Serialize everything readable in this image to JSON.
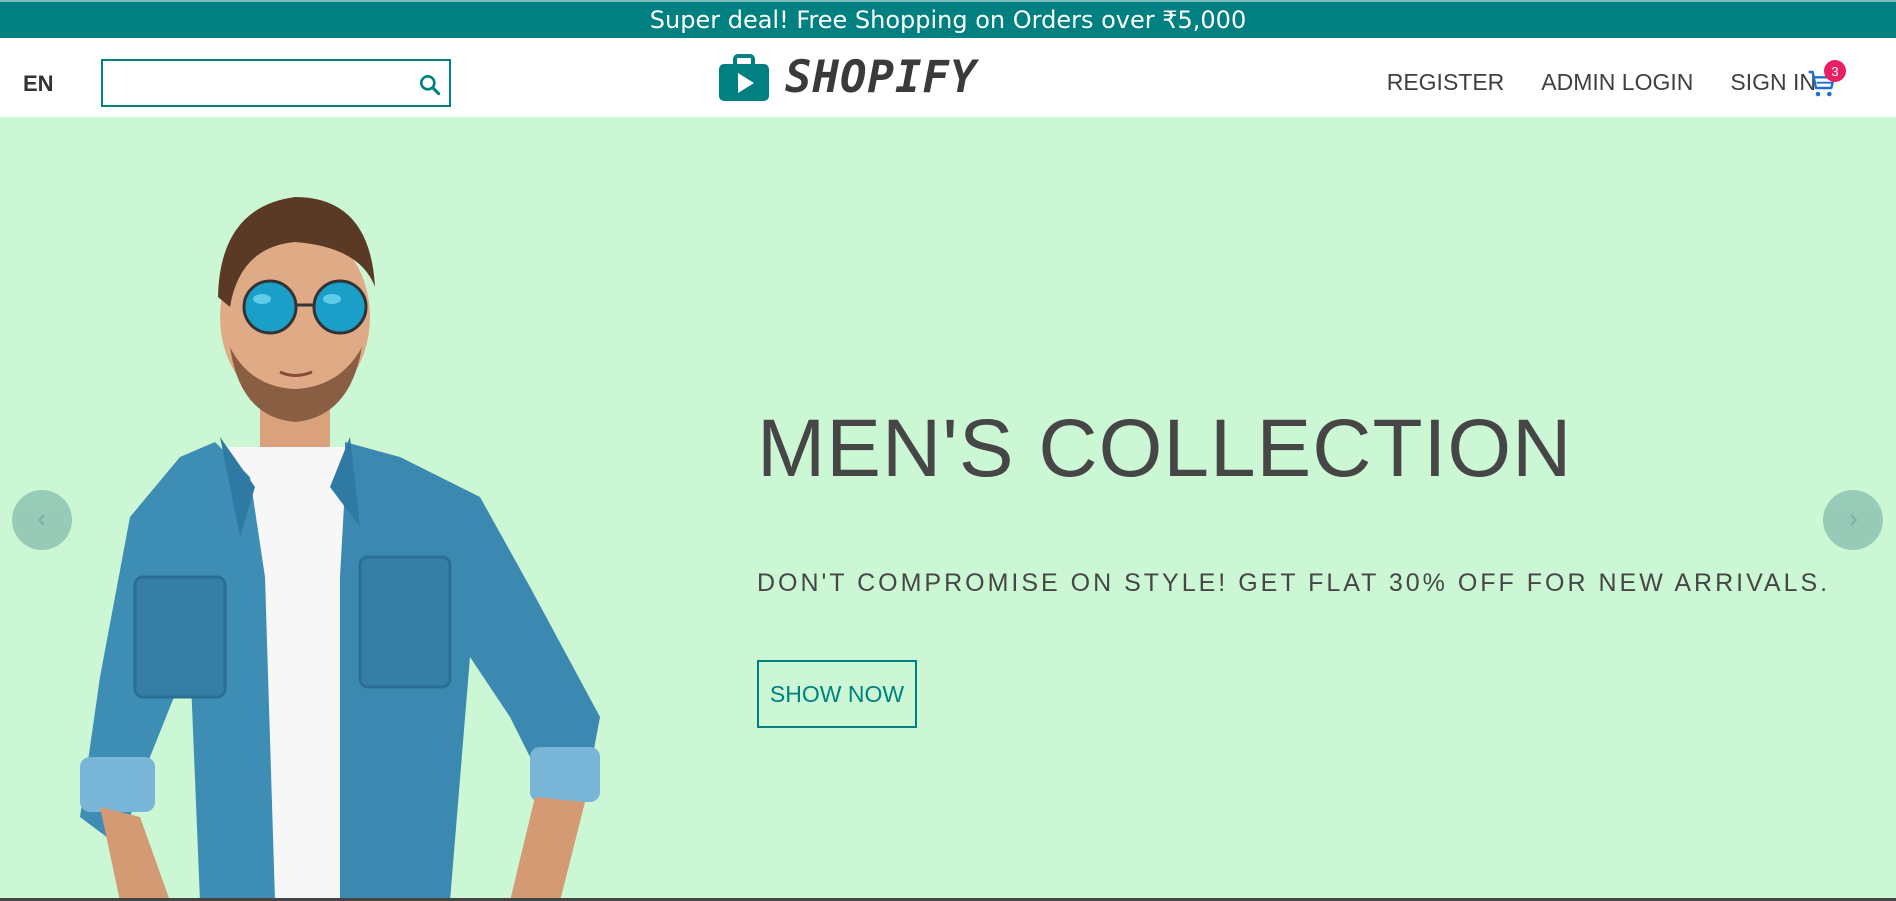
{
  "announcement": {
    "text": "Super deal! Free Shopping on Orders over ₹5,000"
  },
  "header": {
    "language": "EN",
    "search": {
      "value": "",
      "placeholder": ""
    },
    "logo_text": "SHOPIFY",
    "links": [
      "REGISTER",
      "ADMIN LOGIN",
      "SIGN IN"
    ],
    "cart_count": "3"
  },
  "hero": {
    "title": "MEN'S COLLECTION",
    "description": "DON'T COMPROMISE ON STYLE! GET FLAT 30% OFF FOR NEW ARRIVALS.",
    "button_label": "SHOW NOW"
  },
  "colors": {
    "brand": "#008080",
    "hero_background": "#cbf7d4",
    "badge": "#e91e63",
    "text_dark": "#464646"
  },
  "icons": [
    "search-icon",
    "shopping-bag-play-icon",
    "cart-icon",
    "arrow-left-icon",
    "arrow-right-icon"
  ]
}
